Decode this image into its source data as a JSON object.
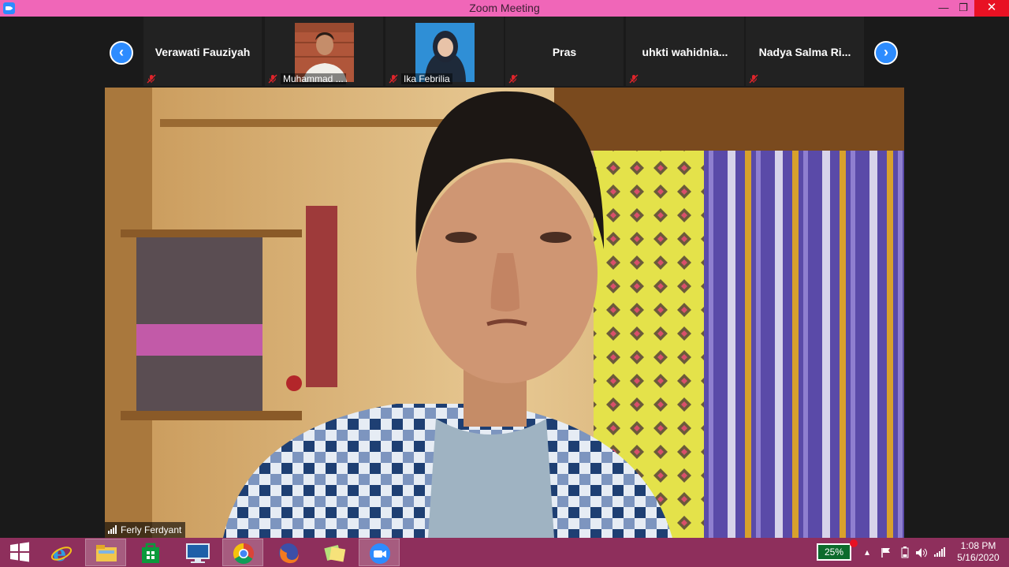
{
  "window": {
    "title": "Zoom Meeting",
    "minimize_glyph": "—",
    "maximize_glyph": "❐",
    "close_glyph": "✕"
  },
  "strip": {
    "prev_glyph": "‹",
    "next_glyph": "›",
    "participants": [
      {
        "name": "Verawati Fauziyah",
        "muted": true,
        "has_video": false
      },
      {
        "name": "Muhammad ...",
        "muted": true,
        "has_video": true
      },
      {
        "name": "Ika Febrilia",
        "muted": true,
        "has_video": true
      },
      {
        "name": "Pras",
        "muted": true,
        "has_video": false
      },
      {
        "name": "uhkti  wahidnia...",
        "muted": true,
        "has_video": false
      },
      {
        "name": "Nadya  Salma  Ri...",
        "muted": true,
        "has_video": false
      }
    ]
  },
  "main_video": {
    "speaker": "Ferly Ferdyant"
  },
  "taskbar": {
    "apps": [
      "start-icon",
      "internet-explorer-icon",
      "file-explorer-icon",
      "store-icon",
      "lenovo-icon",
      "chrome-icon",
      "firefox-icon",
      "sticky-notes-icon",
      "zoom-icon"
    ],
    "battery": "25%",
    "time": "1:08 PM",
    "date": "5/16/2020"
  },
  "colors": {
    "titlebar": "#f066b8",
    "taskbar": "#8e2f5c",
    "zoom_blue": "#2d8cff",
    "muted_red": "#e0242b"
  }
}
